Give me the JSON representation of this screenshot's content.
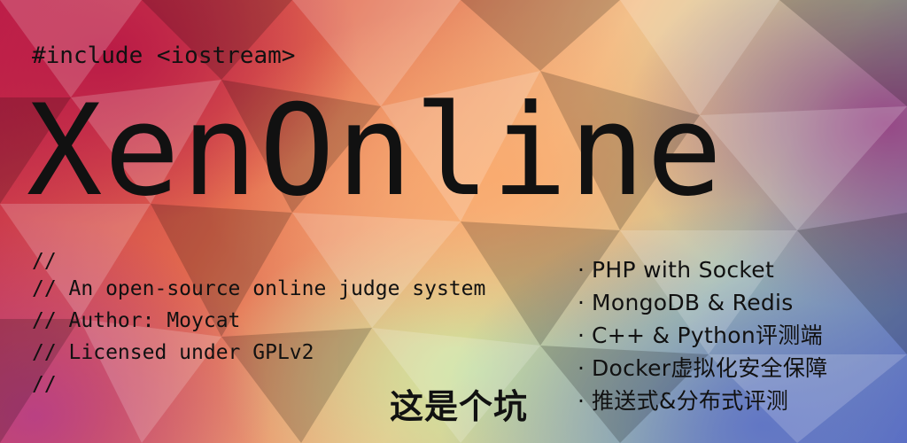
{
  "banner": {
    "include_line": "#include <iostream>",
    "title": "XenOnline",
    "comment_lines": [
      "//",
      "// An open-source online judge system",
      "// Author: Moycat",
      "// Licensed under GPLv2",
      "//"
    ],
    "feature_bullet": "·",
    "features": [
      "PHP with Socket",
      "MongoDB & Redis",
      "C++ & Python评测端",
      "Docker虚拟化安全保障",
      "推送式&分布式评测"
    ],
    "tagline": "这是个坑"
  },
  "colors": {
    "text": "#111111",
    "background_palette": [
      "#c0224a",
      "#e26a4e",
      "#f3c08a",
      "#b9d7a6",
      "#5b6fc0",
      "#963c82"
    ]
  }
}
